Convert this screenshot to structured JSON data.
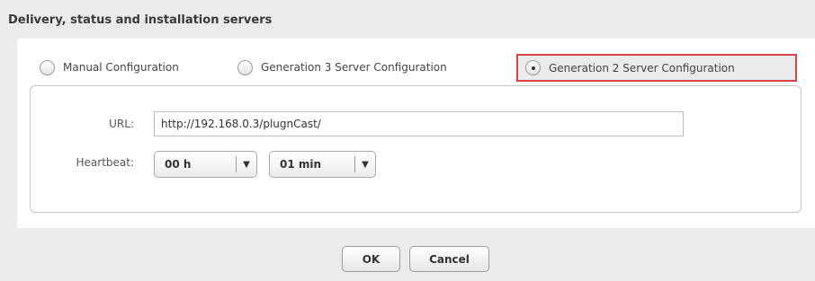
{
  "dialog": {
    "title": "Delivery, status and installation servers"
  },
  "config_modes": {
    "options": [
      {
        "label": "Manual Configuration",
        "checked": false
      },
      {
        "label": "Generation 3 Server Configuration",
        "checked": false
      },
      {
        "label": "Generation 2 Server Configuration",
        "checked": true
      }
    ]
  },
  "form": {
    "url_label": "URL:",
    "url_value": "http://192.168.0.3/plugnCast/",
    "heartbeat_label": "Heartbeat:",
    "hours_value": "00 h",
    "minutes_value": "01 min"
  },
  "icons": {
    "dropdown_arrow": "▼"
  },
  "footer": {
    "ok_label": "OK",
    "cancel_label": "Cancel"
  },
  "colors": {
    "highlight_border": "#d64545",
    "background": "#ebebeb"
  }
}
